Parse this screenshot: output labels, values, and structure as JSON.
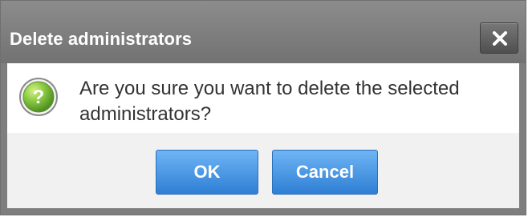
{
  "dialog": {
    "title": "Delete administrators",
    "close_icon": "close-icon",
    "message_icon": "question-icon",
    "message": "Are you sure you want to delete the selected administrators?",
    "buttons": {
      "ok_label": "OK",
      "cancel_label": "Cancel"
    },
    "colors": {
      "titlebar": "#808080",
      "button": "#3d8fe0",
      "footer": "#f1f1f1",
      "icon": "#74b53a"
    }
  }
}
